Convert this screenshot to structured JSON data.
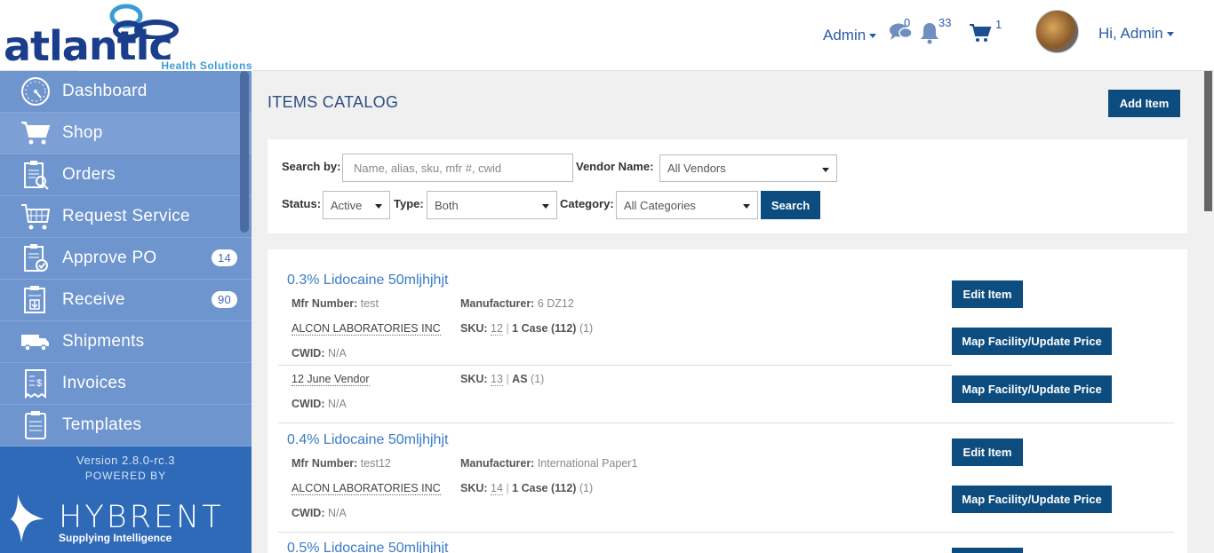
{
  "brand": {
    "name": "atlantic",
    "tagline": "Health Solutions"
  },
  "header": {
    "admin_menu": "Admin",
    "chat_count": "0",
    "notification_count": "33",
    "cart_count": "1",
    "greeting": "Hi, Admin"
  },
  "sidebar": {
    "items": [
      {
        "label": "Dashboard",
        "icon": "dashboard-gauge-icon"
      },
      {
        "label": "Shop",
        "icon": "cart-icon"
      },
      {
        "label": "Orders",
        "icon": "orders-clipboard-icon"
      },
      {
        "label": "Request Service",
        "icon": "request-service-cart-icon"
      },
      {
        "label": "Approve PO",
        "icon": "approve-clipboard-icon",
        "badge": "14"
      },
      {
        "label": "Receive",
        "icon": "receive-clipboard-icon",
        "badge": "90"
      },
      {
        "label": "Shipments",
        "icon": "truck-icon"
      },
      {
        "label": "Invoices",
        "icon": "invoice-icon"
      },
      {
        "label": "Templates",
        "icon": "template-icon"
      }
    ],
    "version": "Version 2.8.0-rc.3",
    "powered_by": "POWERED BY",
    "powered_brand": "HYBRENT",
    "powered_tagline": "Supplying Intelligence"
  },
  "page": {
    "title": "ITEMS CATALOG",
    "add_item_label": "Add Item"
  },
  "filters": {
    "search_label": "Search by:",
    "search_placeholder": "Name, alias, sku, mfr #, cwid",
    "vendor_label": "Vendor Name:",
    "vendor_value": "All Vendors",
    "status_label": "Status:",
    "status_value": "Active",
    "type_label": "Type:",
    "type_value": "Both",
    "category_label": "Category:",
    "category_value": "All Categories",
    "search_button": "Search"
  },
  "items": [
    {
      "name": "0.3% Lidocaine 50mljhjhjt",
      "mfr_label": "Mfr Number:",
      "mfr_value": "test",
      "manufacturer_label": "Manufacturer:",
      "manufacturer_value": "6 DZ12",
      "vendors": [
        {
          "name": "ALCON LABORATORIES INC",
          "sku_label": "SKU:",
          "sku": "12",
          "pack": "1 Case (112)",
          "qty": "(1)",
          "cwid_label": "CWID:",
          "cwid": "N/A"
        },
        {
          "name": "12 June Vendor",
          "sku_label": "SKU:",
          "sku": "13",
          "pack": "AS",
          "qty": "(1)",
          "cwid_label": "CWID:",
          "cwid": "N/A"
        }
      ],
      "edit_label": "Edit Item",
      "map_label": "Map Facility/Update Price"
    },
    {
      "name": "0.4% Lidocaine 50mljhjhjt",
      "mfr_label": "Mfr Number:",
      "mfr_value": "test12",
      "manufacturer_label": "Manufacturer:",
      "manufacturer_value": "International Paper1",
      "vendors": [
        {
          "name": "ALCON LABORATORIES INC",
          "sku_label": "SKU:",
          "sku": "14",
          "pack": "1 Case (112)",
          "qty": "(1)",
          "cwid_label": "CWID:",
          "cwid": "N/A"
        }
      ],
      "edit_label": "Edit Item",
      "map_label": "Map Facility/Update Price"
    },
    {
      "name": "0.5% Lidocaine 50mljhjhjt"
    }
  ],
  "colors": {
    "primary_button": "#0d4c7f",
    "sidebar_nav": "#6f95cf",
    "sidebar_footer": "#2f6ab9",
    "link": "#3a7bc8",
    "brand_dark": "#1a3e8c"
  }
}
